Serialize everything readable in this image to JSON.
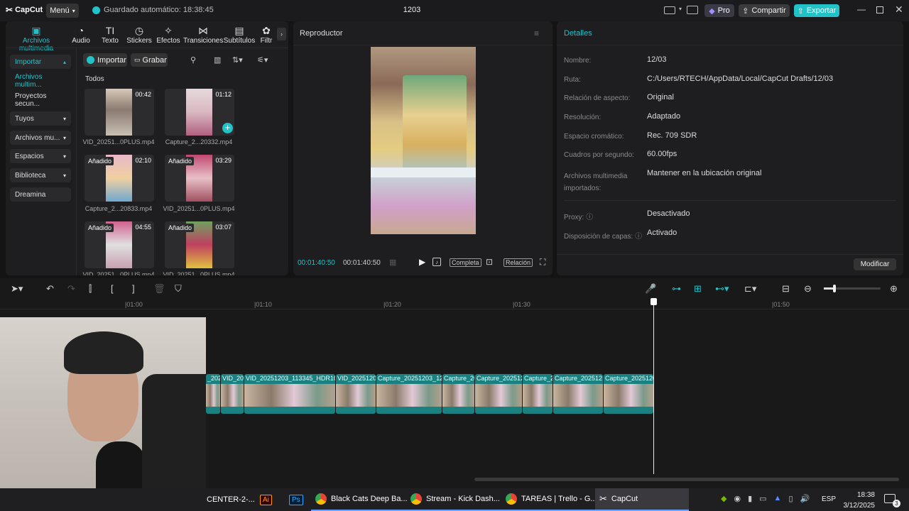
{
  "titlebar": {
    "app_name": "CapCut",
    "menu_label": "Menú",
    "autosave": "Guardado automático: 18:38:45",
    "project_title": "1203",
    "pro_label": "Pro",
    "share_label": "Compartir",
    "export_label": "Exportar"
  },
  "media_tabs": [
    {
      "label": "Archivos multimedia",
      "icon": "media-icon"
    },
    {
      "label": "Audio",
      "icon": "audio-icon"
    },
    {
      "label": "Texto",
      "icon": "text-icon"
    },
    {
      "label": "Stickers",
      "icon": "stickers-icon"
    },
    {
      "label": "Efectos",
      "icon": "effects-icon"
    },
    {
      "label": "Transiciones",
      "icon": "transitions-icon"
    },
    {
      "label": "Subtítulos",
      "icon": "subtitles-icon"
    },
    {
      "label": "Filtr",
      "icon": "filters-icon"
    }
  ],
  "sidebar": {
    "items": [
      {
        "label": "Importar"
      },
      {
        "label": "Archivos multim..."
      },
      {
        "label": "Proyectos secun..."
      },
      {
        "label": "Tuyos"
      },
      {
        "label": "Archivos mu..."
      },
      {
        "label": "Espacios"
      },
      {
        "label": "Biblioteca"
      },
      {
        "label": "Dreamina"
      }
    ]
  },
  "media": {
    "import_label": "Importar",
    "record_label": "Grabar",
    "section_label": "Todos",
    "added_badge": "Añadido",
    "items": [
      {
        "name": "VID_20251...0PLUS.mp4",
        "duration": "00:42"
      },
      {
        "name": "Capture_2...20332.mp4",
        "duration": "01:12"
      },
      {
        "name": "Capture_2...20833.mp4",
        "duration": "02:10"
      },
      {
        "name": "VID_20251...0PLUS.mp4",
        "duration": "03:29"
      },
      {
        "name": "VID_20251...0PLUS.mp4",
        "duration": "04:55"
      },
      {
        "name": "VID_20251...0PLUS.mp4",
        "duration": "03:07"
      }
    ]
  },
  "player": {
    "title": "Reproductor",
    "current_time": "00:01:40:50",
    "total_time": "00:01:40:50",
    "full_label": "Completa",
    "ratio_label": "Relación"
  },
  "details": {
    "title": "Detalles",
    "rows": [
      {
        "label": "Nombre:",
        "value": "12/03"
      },
      {
        "label": "Ruta:",
        "value": "C:/Users/RTECH/AppData/Local/CapCut Drafts/12/03"
      },
      {
        "label": "Relación de aspecto:",
        "value": "Original"
      },
      {
        "label": "Resolución:",
        "value": "Adaptado"
      },
      {
        "label": "Espacio cromático:",
        "value": "Rec. 709 SDR"
      },
      {
        "label": "Cuadros por segundo:",
        "value": "60.00fps"
      },
      {
        "label": "Archivos multimedia importados:",
        "value": "Mantener en la ubicación original"
      },
      {
        "label": "Proxy:",
        "value": "Desactivado"
      },
      {
        "label": "Disposición de capas:",
        "value": "Activado"
      }
    ],
    "modify_label": "Modificar"
  },
  "timeline": {
    "ruler": [
      "|01:00",
      "|01:10",
      "|01:20",
      "|01:30",
      "|01:50"
    ],
    "clips": [
      "_202",
      "VID_202",
      "VID_20251203_113345_HDR10PL",
      "VID_2025120",
      "Capture_20251203_120",
      "Capture_20",
      "Capture_2025120",
      "Capture_2",
      "Capture_202512",
      "Capture_2025120"
    ]
  },
  "taskbar": {
    "items": [
      {
        "label": "CENTER-2-..."
      },
      {
        "label": ""
      },
      {
        "label": ""
      },
      {
        "label": "Black Cats Deep Ba..."
      },
      {
        "label": "Stream - Kick Dash..."
      },
      {
        "label": "TAREAS | Trello - G..."
      },
      {
        "label": "CapCut"
      }
    ],
    "lang": "ESP",
    "time": "18:38",
    "date": "3/12/2025",
    "notif_count": "3"
  },
  "colors": {
    "accent": "#22c2c9",
    "panel": "#1e1e20",
    "bg": "#141414"
  }
}
